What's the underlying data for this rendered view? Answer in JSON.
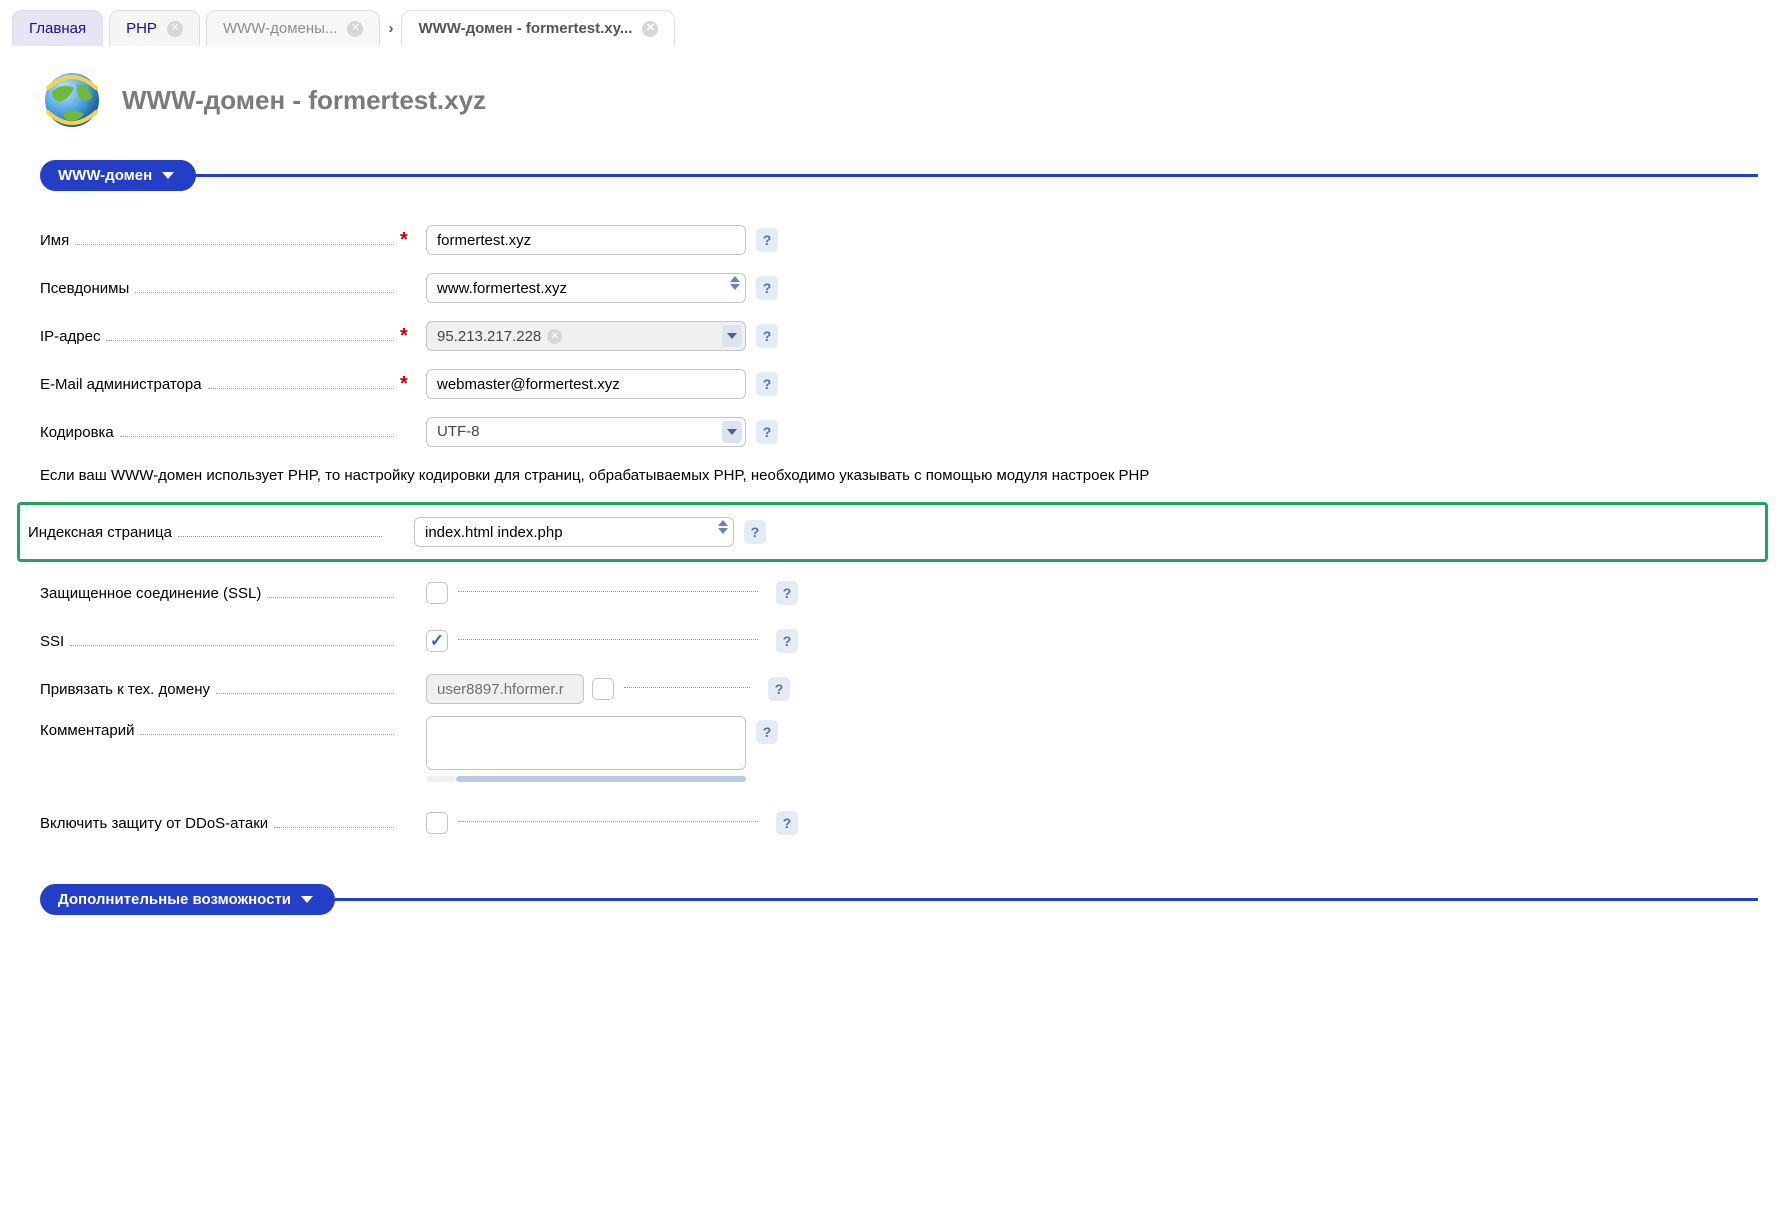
{
  "tabs": {
    "main": "Главная",
    "php": "PHP",
    "wwwdomains": "WWW-домены...",
    "active": "WWW-домен - formertest.xy..."
  },
  "page": {
    "title": "WWW-домен - formertest.xyz"
  },
  "sections": {
    "main": "WWW-домен",
    "extra": "Дополнительные возможности"
  },
  "labels": {
    "name": "Имя",
    "aliases": "Псевдонимы",
    "ip": "IP-адрес",
    "email": "E-Mail администратора",
    "charset": "Кодировка",
    "info": "Если ваш WWW-домен использует PHP, то настройку кодировки для страниц, обрабатываемых PHP, необходимо указывать с помощью модуля настроек PHP",
    "index": "Индексная страница",
    "ssl": "Защищенное соединение (SSL)",
    "ssi": "SSI",
    "techdomain": "Привязать к тех. домену",
    "comment": "Комментарий",
    "ddos": "Включить защиту от DDoS-атаки"
  },
  "values": {
    "name": "formertest.xyz",
    "aliases": "www.formertest.xyz",
    "ip": "95.213.217.228",
    "email": "webmaster@formertest.xyz",
    "charset": "UTF-8",
    "index": "index.html index.php",
    "techdomain": "user8897.hformer.r",
    "comment": ""
  }
}
